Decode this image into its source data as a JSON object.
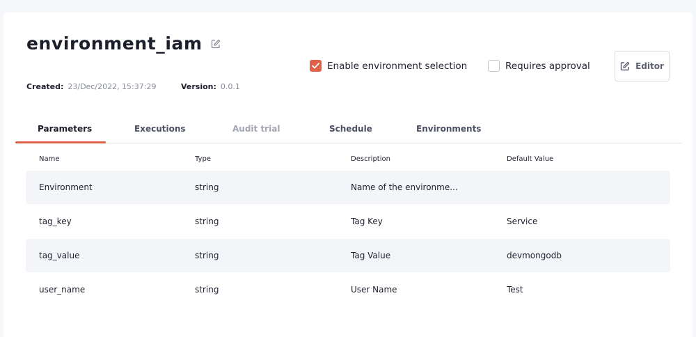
{
  "header": {
    "title": "environment_iam",
    "created_label": "Created:",
    "created_value": "23/Dec/2022, 15:37:29",
    "version_label": "Version:",
    "version_value": "0.0.1"
  },
  "options": {
    "enable_env_selection": {
      "label": "Enable environment selection",
      "checked": true
    },
    "requires_approval": {
      "label": "Requires approval",
      "checked": false
    }
  },
  "editor_button": {
    "label": "Editor",
    "icon": "edit-icon"
  },
  "tabs": [
    {
      "label": "Parameters",
      "state": "active"
    },
    {
      "label": "Executions",
      "state": "normal"
    },
    {
      "label": "Audit trial",
      "state": "disabled"
    },
    {
      "label": "Schedule",
      "state": "normal"
    },
    {
      "label": "Environments",
      "state": "normal"
    }
  ],
  "table": {
    "columns": [
      "Name",
      "Type",
      "Description",
      "Default Value"
    ],
    "rows": [
      {
        "name": "Environment",
        "type": "string",
        "description": "Name of the environme...",
        "default": ""
      },
      {
        "name": "tag_key",
        "type": "string",
        "description": "Tag Key",
        "default": "Service"
      },
      {
        "name": "tag_value",
        "type": "string",
        "description": "Tag Value",
        "default": "devmongodb"
      },
      {
        "name": "user_name",
        "type": "string",
        "description": "User Name",
        "default": "Test"
      }
    ]
  },
  "colors": {
    "accent": "#e06048",
    "background": "#f5f6fa",
    "row_shade": "#f4f5f9"
  }
}
